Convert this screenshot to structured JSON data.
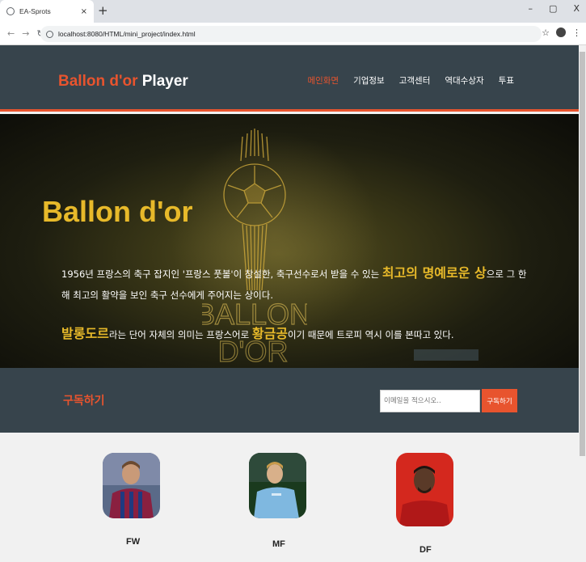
{
  "browser": {
    "tab_title": "EA-Sprots",
    "tab_close": "×",
    "new_tab": "+",
    "url": "localhost:8080/HTML/mini_project/index.html",
    "window_controls": [
      "–",
      "▢",
      "X"
    ]
  },
  "site": {
    "logo_part1": "Ballon d'or ",
    "logo_part2": "Player",
    "nav": [
      "메인화면",
      "기업정보",
      "고객센터",
      "역대수상자",
      "투표"
    ],
    "hero": {
      "title": "Ballon d'or",
      "p1_before": "1956년 프랑스의 축구 잡지인 '프랑스 풋볼'이 창설한, 축구선수로서 받을 수 있는 ",
      "p1_highlight": "최고의 명예로운 상",
      "p1_after": "으로 그 한해 최고의 활약을 보인 축구 선수에게 주어지는 상이다.",
      "p2_highlight": "발롱도르",
      "p2_after": "라는 단어 자체의 의미는 프랑스어로 ",
      "p2_highlight2": "황금공",
      "p2_end": "이기 때문에 트로피 역시 이를 본따고 있다.",
      "trophy_text_1": "BALLON",
      "trophy_text_2": "D'OR"
    },
    "subscribe": {
      "title": "구독하기",
      "placeholder": "이메일을 적으시오..",
      "button": "구독하기"
    },
    "players": [
      {
        "position": "FW"
      },
      {
        "position": "MF"
      },
      {
        "position": "DF"
      }
    ]
  },
  "colors": {
    "accent": "#e8542e",
    "gold": "#e7b92a",
    "header_bg": "#37444c"
  }
}
